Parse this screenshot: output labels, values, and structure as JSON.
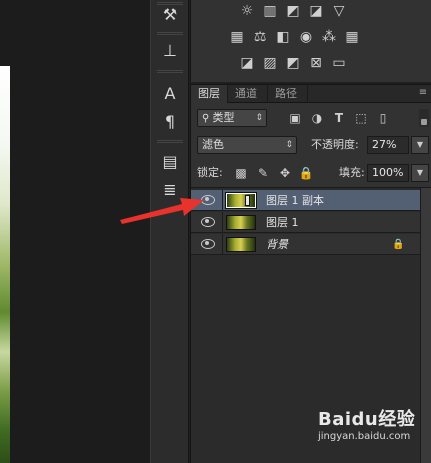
{
  "adjustments": {
    "row1": [
      "brightness-contrast-icon",
      "levels-icon",
      "curves-icon",
      "exposure-icon",
      "gradient-triangle-icon"
    ],
    "row2": [
      "vibrance-icon",
      "balance-icon",
      "black-white-icon",
      "photo-filter-icon",
      "channel-mixer-icon",
      "color-lookup-icon"
    ],
    "row3": [
      "invert-icon",
      "posterize-icon",
      "threshold-icon",
      "selective-color-icon",
      "gradient-map-icon"
    ]
  },
  "tabs": [
    {
      "label": "图层",
      "active": true
    },
    {
      "label": "通道",
      "active": false
    },
    {
      "label": "路径",
      "active": false
    }
  ],
  "filter": {
    "kind_label": "类型"
  },
  "blend": {
    "mode": "滤色",
    "opacity_label": "不透明度:",
    "opacity_value": "27%"
  },
  "lock": {
    "label": "锁定:",
    "fill_label": "填充:",
    "fill_value": "100%"
  },
  "layers": [
    {
      "name": "图层 1 副本",
      "selected": true,
      "locked": false
    },
    {
      "name": "图层 1",
      "selected": false,
      "locked": false
    },
    {
      "name": "背景",
      "selected": false,
      "locked": true
    }
  ],
  "watermark": {
    "brand": "Baidu经验",
    "url": "jingyan.baidu.com"
  },
  "colors": {
    "annotation_arrow": "#e8332d",
    "selection": "#535f73",
    "panel": "#323233"
  }
}
